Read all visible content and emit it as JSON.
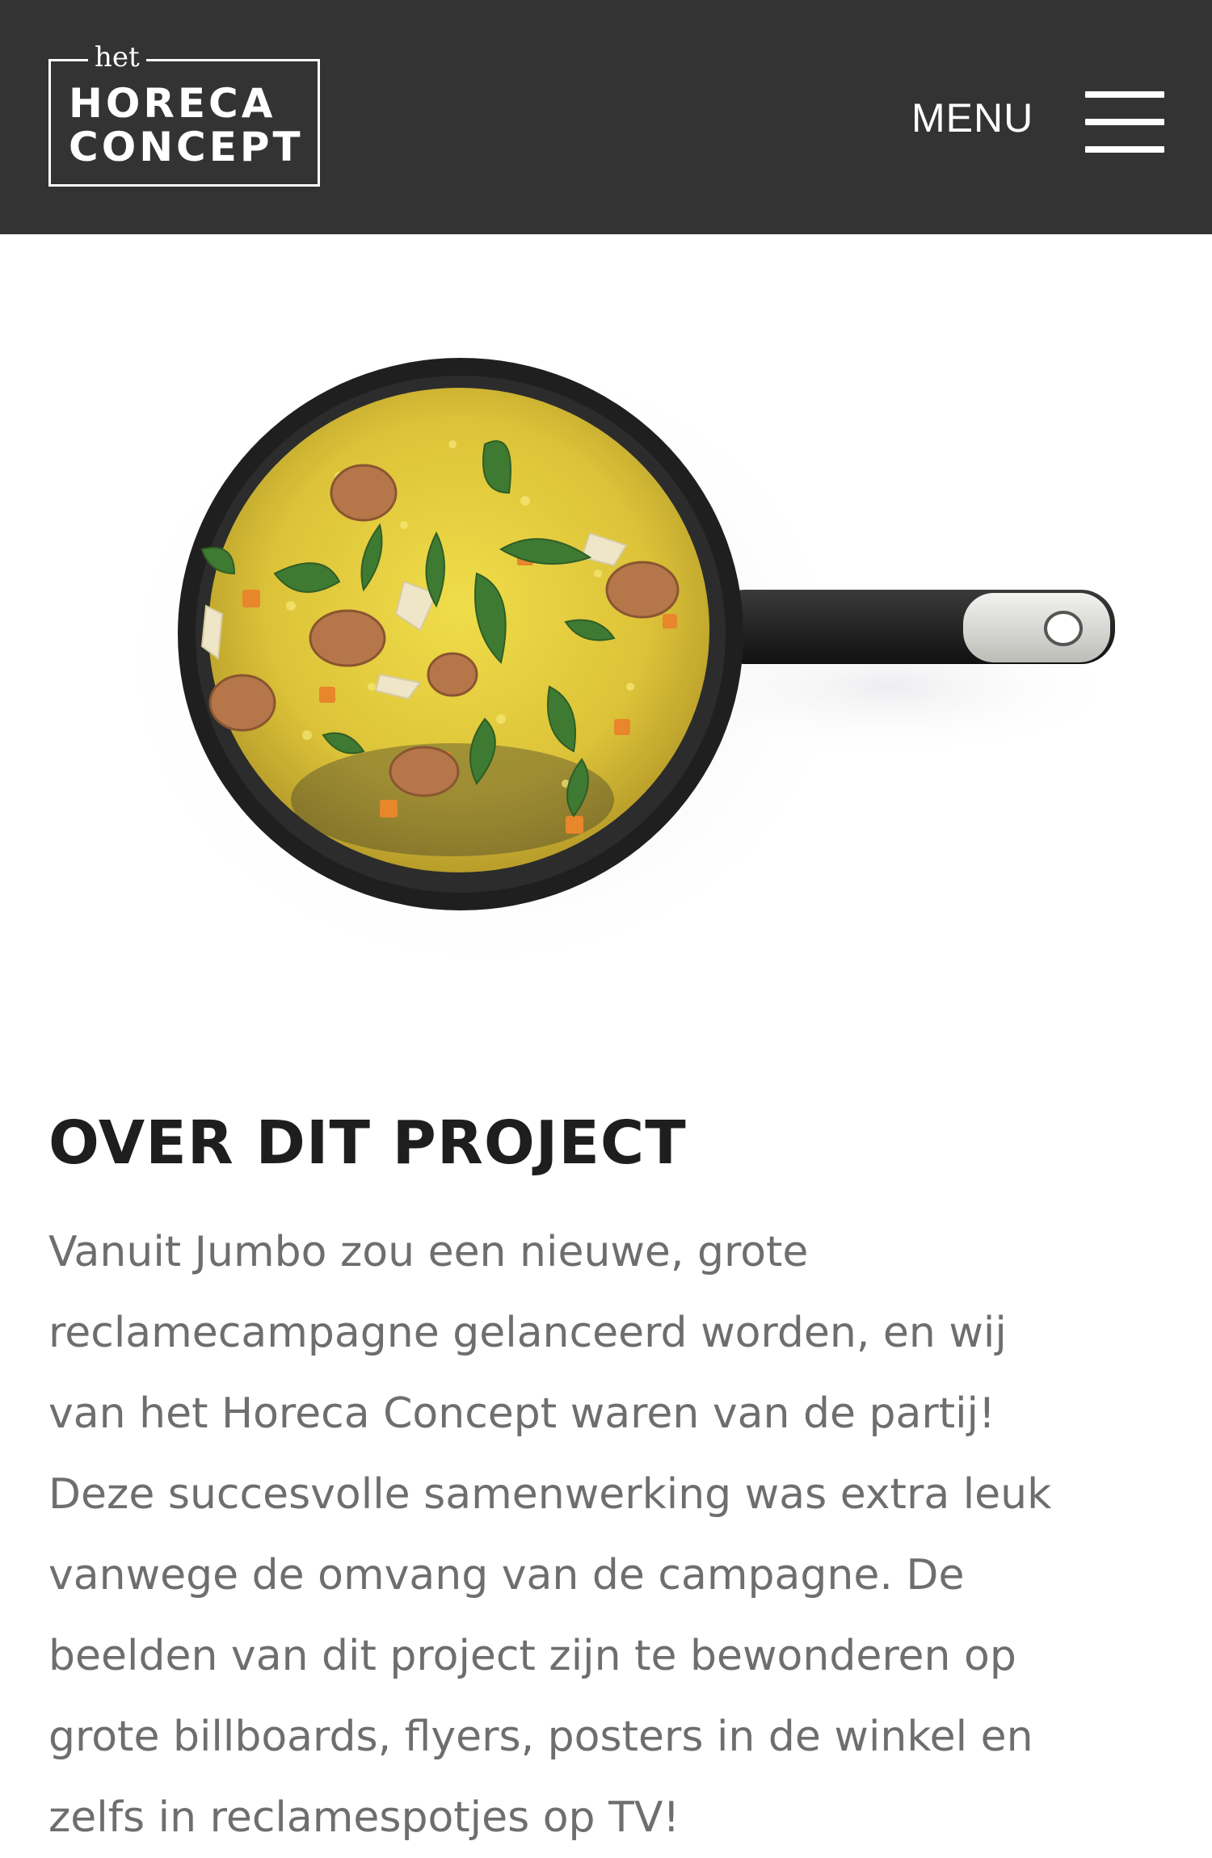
{
  "header": {
    "logo": {
      "small": "het",
      "line1": "HORECA",
      "line2": "CONCEPT"
    },
    "menu_label": "MENU",
    "background_color": "#333333"
  },
  "hero": {
    "image": "pan-of-yellow-rice-with-chicken-and-herbs"
  },
  "project": {
    "title": "OVER DIT PROJECT",
    "lines": [
      "Vanuit Jumbo zou een nieuwe, grote",
      "reclamecampagne gelanceerd worden, en wij",
      "van het Horeca Concept waren van de partij!",
      "Deze succesvolle samenwerking was extra leuk",
      "vanwege de omvang van de campagne. De",
      "beelden van dit project zijn te bewonderen op",
      "grote billboards, flyers, posters in de winkel en",
      "zelfs in reclamespotjes op TV!"
    ]
  },
  "icons": {
    "menu": "hamburger-icon"
  }
}
